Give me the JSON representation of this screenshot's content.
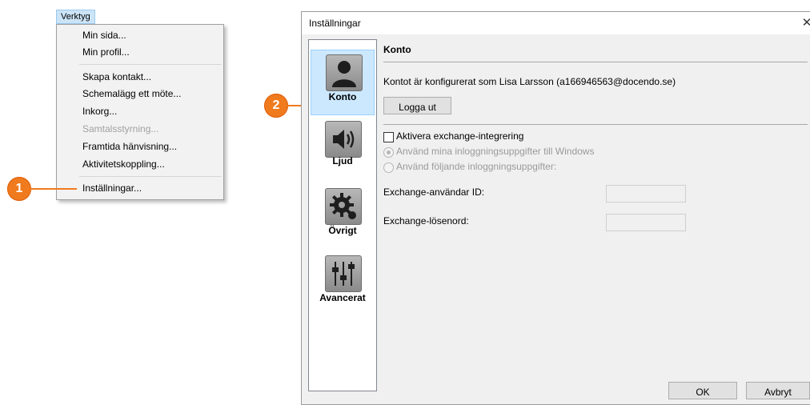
{
  "menu": {
    "title": "Verktyg",
    "items": [
      "Min sida...",
      "Min profil...",
      "Skapa kontakt...",
      "Schemalägg ett möte...",
      "Inkorg...",
      "Samtalsstyrning...",
      "Framtida hänvisning...",
      "Aktivitetskoppling...",
      "Inställningar..."
    ]
  },
  "callouts": {
    "one": "1",
    "two": "2"
  },
  "colors": {
    "accent": "#f07a1e",
    "selection": "#cce8ff"
  },
  "dialog": {
    "title": "Inställningar",
    "close_icon": "✕",
    "nav": [
      {
        "label": "Konto",
        "icon": "user-icon"
      },
      {
        "label": "Ljud",
        "icon": "speaker-icon"
      },
      {
        "label": "Övrigt",
        "icon": "gear-icon"
      },
      {
        "label": "Avancerat",
        "icon": "sliders-icon"
      }
    ],
    "section_title": "Konto",
    "account_text": "Kontot är konfigurerat som Lisa Larsson (a166946563@docendo.se)",
    "logout_label": "Logga ut",
    "exchange_checkbox": "Aktivera exchange-integrering",
    "radio_windows": "Använd mina inloggningsuppgifter till Windows",
    "radio_custom": "Använd följande inloggningsuppgifter:",
    "user_id_label": "Exchange-användar ID:",
    "password_label": "Exchange-lösenord:",
    "ok_label": "OK",
    "cancel_label": "Avbryt"
  }
}
